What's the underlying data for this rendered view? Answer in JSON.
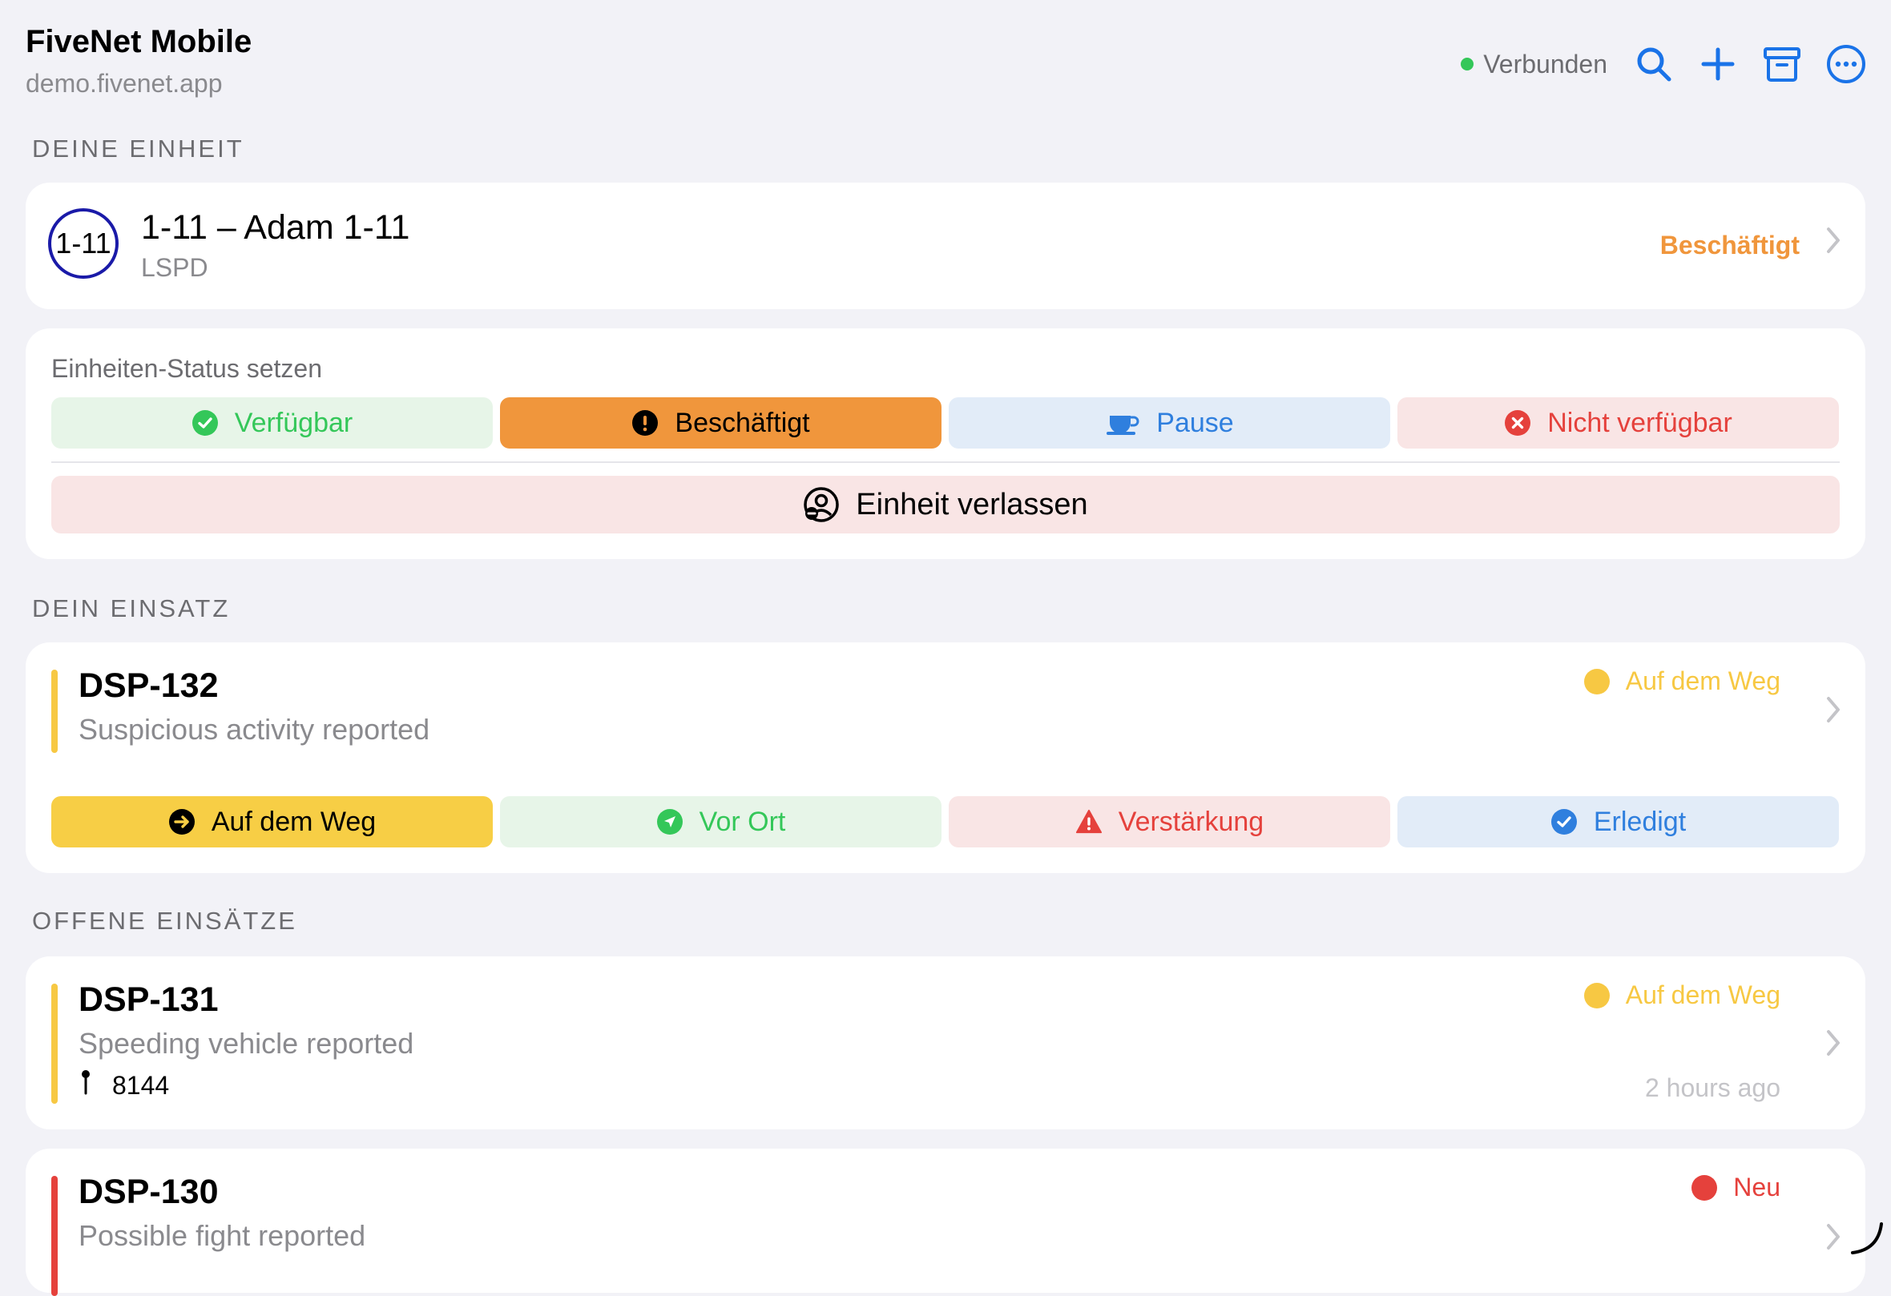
{
  "header": {
    "title": "FiveNet Mobile",
    "subtitle": "demo.fivenet.app",
    "connection_status": "Verbunden",
    "icons": [
      "search-icon",
      "plus-icon",
      "archive-icon",
      "more-icon"
    ]
  },
  "your_unit": {
    "section_label": "DEINE EINHEIT",
    "badge": "1-11",
    "title": "1-11 – Adam 1-11",
    "subtitle": "LSPD",
    "status": "Beschäftigt"
  },
  "unit_status": {
    "title": "Einheiten-Status setzen",
    "buttons": [
      {
        "label": "Verfügbar",
        "icon": "check-circle-icon",
        "bg": "#e7f5e8",
        "color": "#34c759",
        "icon_color": "#34c759"
      },
      {
        "label": "Beschäftigt",
        "icon": "exclamation-circle-icon",
        "bg": "#f0963c",
        "color": "#000000",
        "icon_color": "#000000"
      },
      {
        "label": "Pause",
        "icon": "coffee-cup-icon",
        "bg": "#e2ecf8",
        "color": "#2f7fde",
        "icon_color": "#2f7fde"
      },
      {
        "label": "Nicht verfügbar",
        "icon": "x-circle-icon",
        "bg": "#f9e5e5",
        "color": "#e5413c",
        "icon_color": "#e5413c"
      }
    ],
    "leave_label": "Einheit verlassen",
    "leave_icon": "leave-unit-icon",
    "leave_bg": "#f9e5e5"
  },
  "your_incident": {
    "section_label": "DEIN EINSATZ",
    "id": "DSP-132",
    "description": "Suspicious activity reported",
    "status": "Auf dem Weg",
    "status_color": "#f7c843",
    "stripe_color": "#f7c843",
    "buttons": [
      {
        "label": "Auf dem Weg",
        "icon": "arrow-right-circle-icon",
        "bg": "#f7ce45",
        "color": "#000000",
        "icon_color": "#000000"
      },
      {
        "label": "Vor Ort",
        "icon": "location-arrow-icon",
        "bg": "#e7f5e8",
        "color": "#34c759",
        "icon_color": "#34c759"
      },
      {
        "label": "Verstärkung",
        "icon": "warning-triangle-icon",
        "bg": "#f9e5e5",
        "color": "#e5413c",
        "icon_color": "#e5413c"
      },
      {
        "label": "Erledigt",
        "icon": "check-badge-icon",
        "bg": "#e2ecf8",
        "color": "#2f7fde",
        "icon_color": "#2f7fde"
      }
    ]
  },
  "open_incidents": {
    "section_label": "OFFENE EINSÄTZE",
    "items": [
      {
        "id": "DSP-131",
        "description": "Speeding vehicle reported",
        "status": "Auf dem Weg",
        "status_color": "#f7c843",
        "stripe_color": "#f7c843",
        "location": "8144",
        "time": "2 hours ago"
      },
      {
        "id": "DSP-130",
        "description": "Possible fight reported",
        "status": "Neu",
        "status_color": "#e5413c",
        "stripe_color": "#e5413c"
      }
    ]
  }
}
